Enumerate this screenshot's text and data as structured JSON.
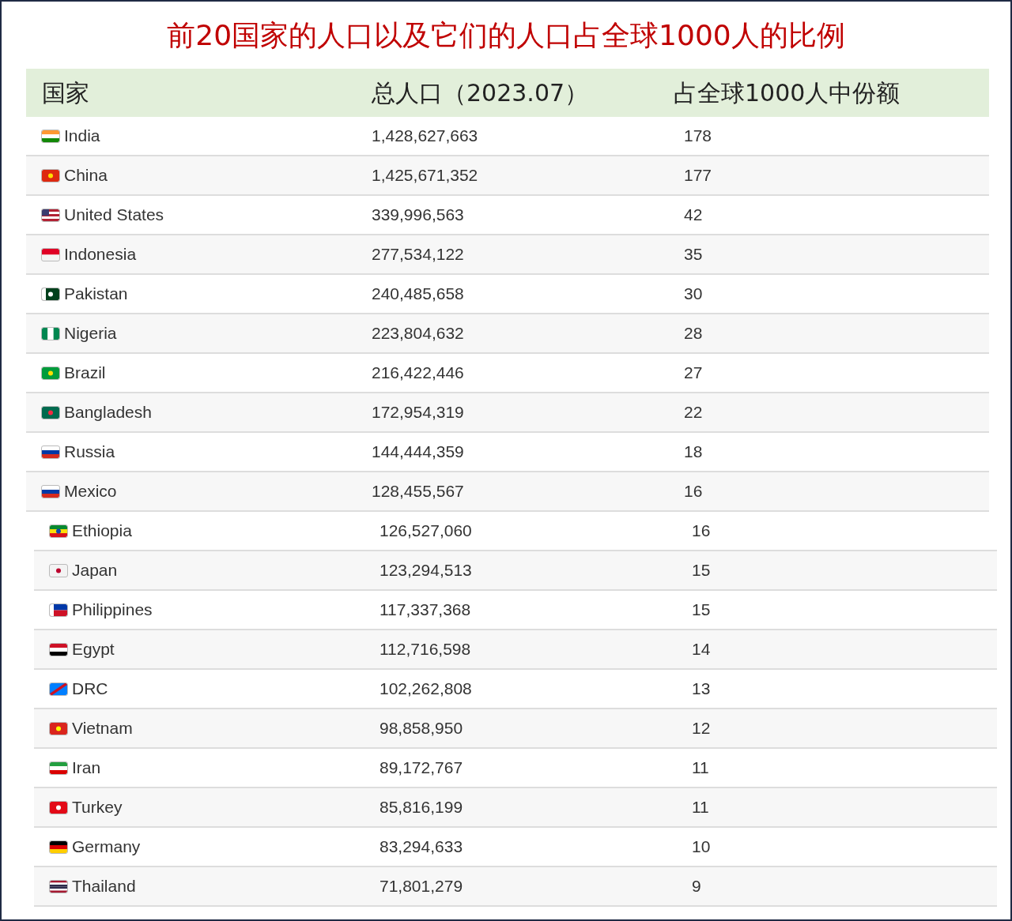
{
  "title": "前20国家的人口以及它们的人口占全球1000人的比例",
  "table": {
    "columns": [
      "国家",
      "总人口（2023.07）",
      "占全球1000人中份额"
    ],
    "rows": [
      {
        "country": "India",
        "population": "1,428,627,663",
        "share": "178"
      },
      {
        "country": "China",
        "population": "1,425,671,352",
        "share": "177"
      },
      {
        "country": "United States",
        "population": "339,996,563",
        "share": "42"
      },
      {
        "country": "Indonesia",
        "population": "277,534,122",
        "share": "35"
      },
      {
        "country": "Pakistan",
        "population": "240,485,658",
        "share": "30"
      },
      {
        "country": "Nigeria",
        "population": "223,804,632",
        "share": "28"
      },
      {
        "country": "Brazil",
        "population": "216,422,446",
        "share": "27"
      },
      {
        "country": "Bangladesh",
        "population": "172,954,319",
        "share": "22"
      },
      {
        "country": "Russia",
        "population": "144,444,359",
        "share": "18"
      },
      {
        "country": "Mexico",
        "population": "128,455,567",
        "share": "16"
      },
      {
        "country": "Ethiopia",
        "population": "126,527,060",
        "share": "16"
      },
      {
        "country": "Japan",
        "population": "123,294,513",
        "share": "15"
      },
      {
        "country": "Philippines",
        "population": "117,337,368",
        "share": "15"
      },
      {
        "country": "Egypt",
        "population": "112,716,598",
        "share": "14"
      },
      {
        "country": "DRC",
        "population": "102,262,808",
        "share": "13"
      },
      {
        "country": "Vietnam",
        "population": "98,858,950",
        "share": "12"
      },
      {
        "country": "Iran",
        "population": "89,172,767",
        "share": "11"
      },
      {
        "country": "Turkey",
        "population": "85,816,199",
        "share": "11"
      },
      {
        "country": "Germany",
        "population": "83,294,633",
        "share": "10"
      },
      {
        "country": "Thailand",
        "population": "71,801,279",
        "share": "9"
      }
    ]
  }
}
